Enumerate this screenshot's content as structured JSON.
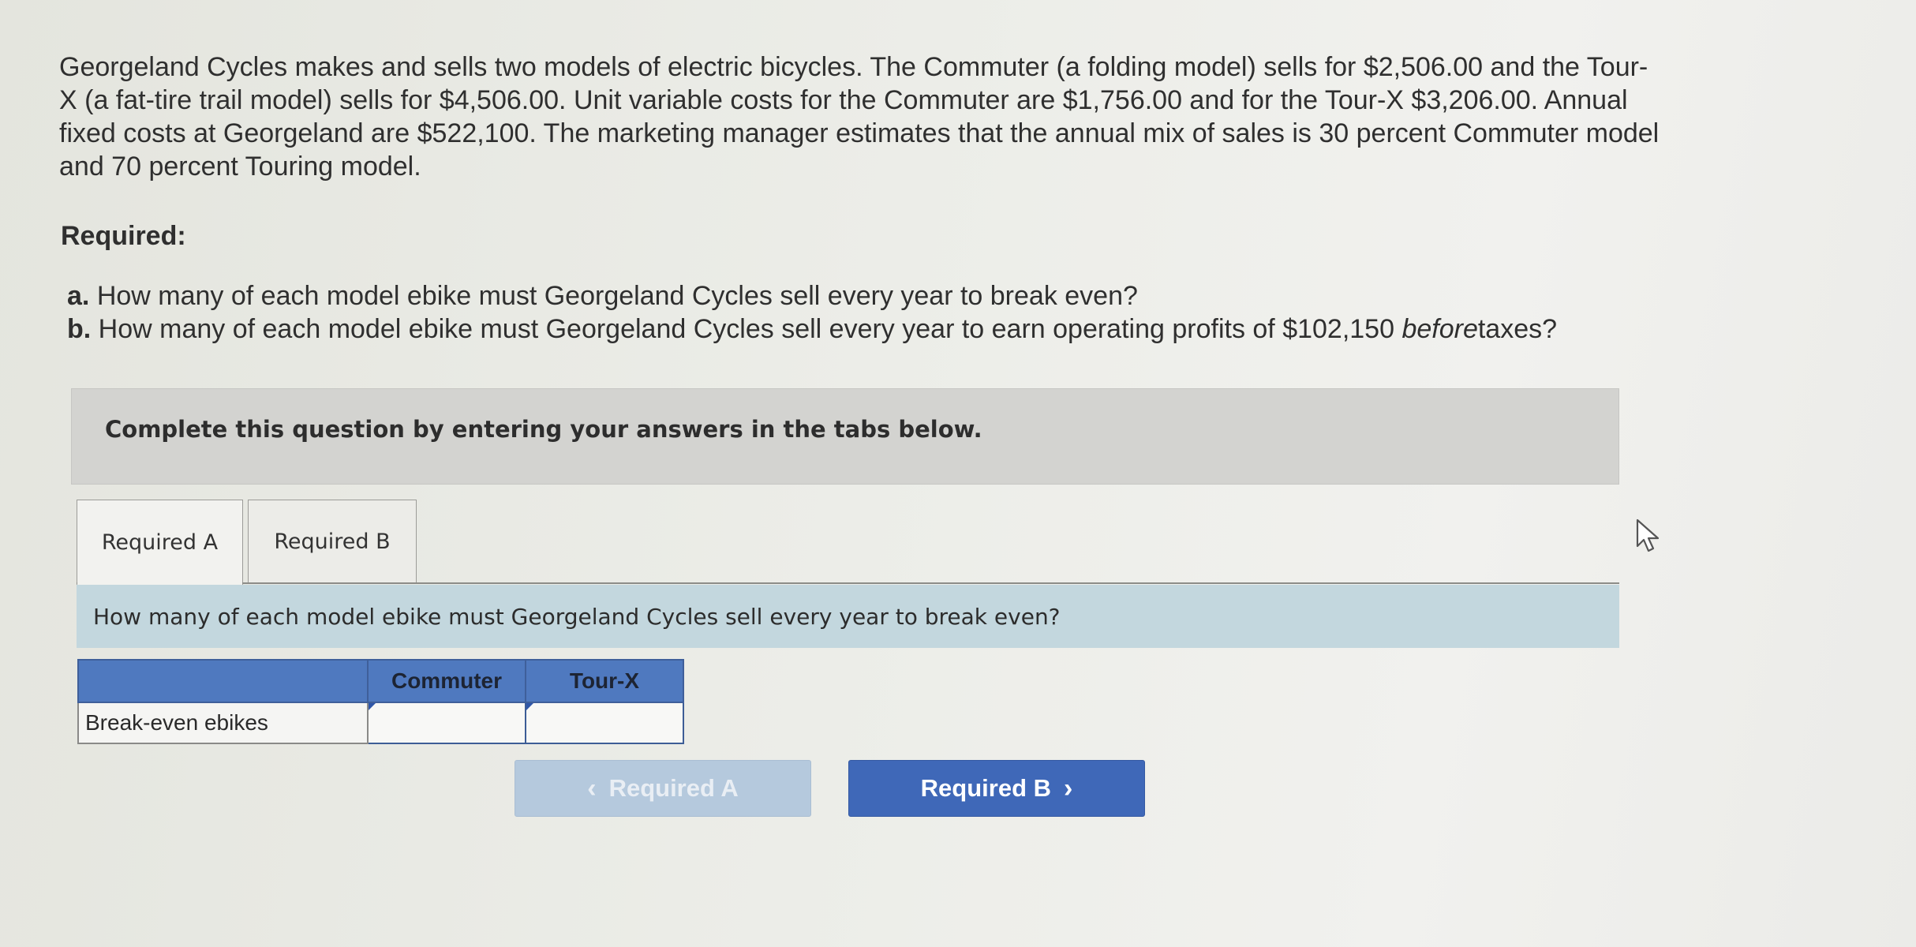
{
  "problem": {
    "line1": "Georgeland Cycles makes and sells two models of electric bicycles. The Commuter (a folding model) sells for $2,506.00 and the Tour-",
    "line2": "X (a fat-tire trail model) sells for $4,506.00. Unit variable costs for the Commuter are $1,756.00 and for the Tour-X $3,206.00. Annual",
    "line3": "fixed costs at Georgeland are $522,100. The marketing manager estimates that the annual mix of sales is 30 percent Commuter model",
    "line4": "and 70 percent Touring model."
  },
  "required": {
    "heading": "Required:",
    "a_letter": "a.",
    "a_text": "How many of each model ebike must Georgeland Cycles sell every year to break even?",
    "b_letter": "b.",
    "b_text_1": "How many of each model ebike must Georgeland Cycles sell every year to earn operating profits of $102,150",
    "b_text_em": "before",
    "b_text_2": "taxes?"
  },
  "instruction": "Complete this question by entering your answers in the tabs below.",
  "tabs": [
    {
      "label": "Required A",
      "active": true
    },
    {
      "label": "Required B",
      "active": false
    }
  ],
  "question": "How many of each model ebike must Georgeland Cycles sell every year to break even?",
  "table": {
    "columns": [
      "Commuter",
      "Tour-X"
    ],
    "row_label": "Break-even ebikes",
    "values": [
      "",
      ""
    ]
  },
  "nav": {
    "prev_label": "Required A",
    "next_label": "Required B"
  },
  "colors": {
    "header_blue": "#4f79bf",
    "question_bg": "#c3d7de",
    "next_button": "#3f68b8",
    "prev_button_disabled": "#b5c9dd"
  }
}
